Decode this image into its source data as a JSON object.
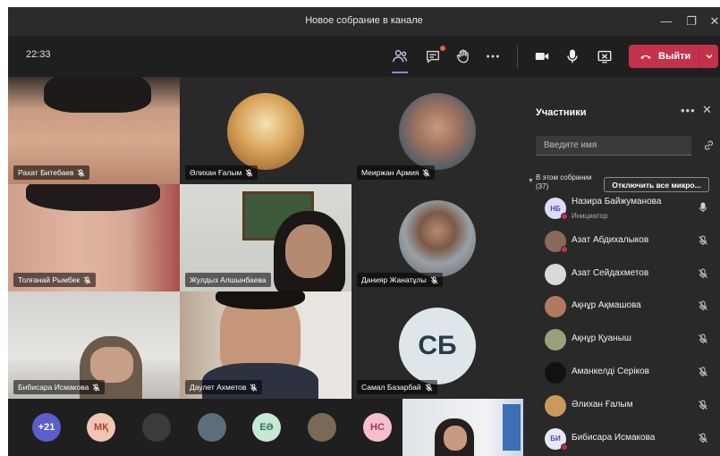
{
  "window": {
    "title": "Новое собрание в канале",
    "minimize": "—",
    "restore": "❐",
    "close": "✕"
  },
  "toolbar": {
    "clock": "22:33",
    "leave_label": "Выйти",
    "icons": [
      "participants-icon",
      "chat-icon",
      "raise-hand-icon",
      "more-options-icon",
      "camera-icon",
      "microphone-icon",
      "share-screen-icon",
      "hang-up-icon",
      "chevron-down-icon"
    ]
  },
  "tiles": [
    {
      "name": "Рахат Битебаев"
    },
    {
      "name": "Әлихан Ғалым"
    },
    {
      "name": "Меиржан Армия"
    },
    {
      "name": "Толғанай Рымбек"
    },
    {
      "name": "Жулдыз Алшынбаева"
    },
    {
      "name": "Данияр Жанатұлы"
    },
    {
      "name": "Бибисара Исмакова"
    },
    {
      "name": "Даулет Ахметов"
    },
    {
      "name": "Самал Базарбай",
      "initials": "СБ"
    }
  ],
  "roster": {
    "overflow_count": "+21",
    "avatars": [
      {
        "initials": "МҚ",
        "bg": "#f2c4b4",
        "fg": "#a6462f"
      },
      {
        "initials": "",
        "bg": "#3b3b3b"
      },
      {
        "initials": "",
        "bg": "#5b6f7a"
      },
      {
        "initials": "ЕӘ",
        "bg": "#c8e8d6",
        "fg": "#2f7a52"
      },
      {
        "initials": "",
        "bg": "#7a6a55"
      },
      {
        "initials": "НС",
        "bg": "#f4c0cc",
        "fg": "#a8354f"
      }
    ]
  },
  "panel": {
    "title": "Участники",
    "more": "•••",
    "close": "✕",
    "search_placeholder": "Введите имя",
    "section_label": "В этом собрании (37)",
    "mute_all_label": "Отключить все микро...",
    "participants": [
      {
        "name": "Назира Байжуманова",
        "role": "Инициатор",
        "initials": "НБ",
        "bg": "#dcdcf5",
        "fg": "#4b4bb5",
        "mic": "on",
        "status": "#c4314b"
      },
      {
        "name": "Азат Абдихалыков",
        "initials": "",
        "bg": "#8a6a5a",
        "mic": "muted",
        "status": "#c4314b"
      },
      {
        "name": "Азат Сейдахметов",
        "initials": "",
        "bg": "#d9d9d9",
        "mic": "muted",
        "status": ""
      },
      {
        "name": "Ақнұр Ақмашова",
        "initials": "",
        "bg": "#b07a60",
        "mic": "muted",
        "status": ""
      },
      {
        "name": "Ақнұр Қуаныш",
        "initials": "",
        "bg": "#9aa07c",
        "mic": "muted",
        "status": ""
      },
      {
        "name": "Аманкелді Серіков",
        "initials": "",
        "bg": "#111111",
        "mic": "muted",
        "status": ""
      },
      {
        "name": "Әлихан Ғалым",
        "initials": "",
        "bg": "#c99a5a",
        "mic": "muted",
        "status": ""
      },
      {
        "name": "Бибисара Исмакова",
        "initials": "БИ",
        "bg": "#e8e8f5",
        "fg": "#4b4bb5",
        "mic": "muted",
        "status": "#c4314b"
      }
    ]
  }
}
